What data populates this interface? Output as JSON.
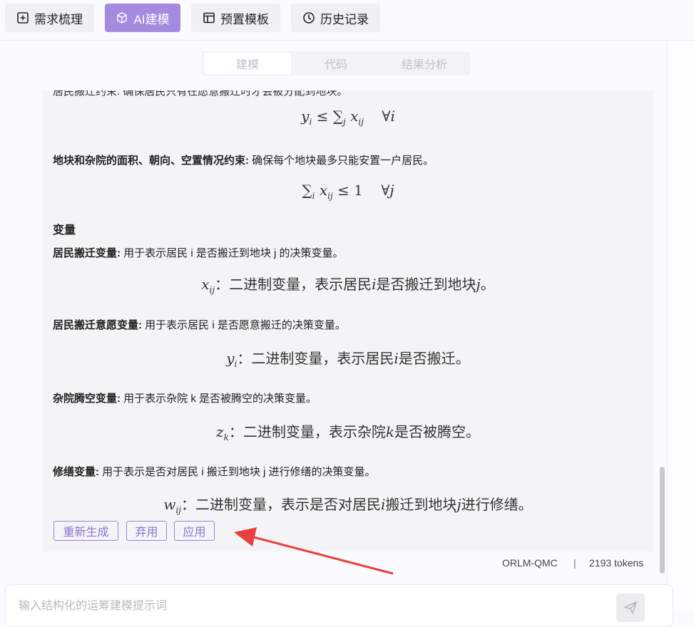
{
  "nav": {
    "items": [
      {
        "label": "需求梳理",
        "icon": "plus-square-icon"
      },
      {
        "label": "AI建模",
        "icon": "cube-icon"
      },
      {
        "label": "预置模板",
        "icon": "layout-icon"
      },
      {
        "label": "历史记录",
        "icon": "clock-icon"
      }
    ],
    "active": "AI建模",
    "accent_color": "#a58be0"
  },
  "tabs": {
    "items": [
      {
        "label": "建模"
      },
      {
        "label": "代码"
      },
      {
        "label": "结果分析"
      }
    ],
    "active": "建模"
  },
  "content": {
    "truncated_top": "居民搬迁约束: 确保居民只有在愿意搬迁时才会被分配到地块。",
    "constraint2": {
      "title": "地块和杂院的面积、朝向、空置情况约束:",
      "desc": " 确保每个地块最多只能安置一户居民。"
    },
    "variables_heading": "变量",
    "var1": {
      "title": "居民搬迁变量:",
      "desc": " 用于表示居民 i 是否搬迁到地块 j 的决策变量。",
      "formula_text": "：二进制变量，表示居民",
      "formula_mid": "是否搬迁到地块",
      "formula_end": "。"
    },
    "var2": {
      "title": "居民搬迁意愿变量:",
      "desc": " 用于表示居民 i 是否愿意搬迁的决策变量。",
      "formula_text": "：二进制变量，表示居民",
      "formula_end": "是否搬迁。"
    },
    "var3": {
      "title": "杂院腾空变量:",
      "desc": " 用于表示杂院 k 是否被腾空的决策变量。",
      "formula_text": "：二进制变量，表示杂院",
      "formula_end": "是否被腾空。"
    },
    "var4": {
      "title": "修缮变量:",
      "desc": " 用于表示是否对居民 i 搬迁到地块 j 进行修缮的决策变量。",
      "formula_text": "：二进制变量，表示是否对居民",
      "formula_mid": "搬迁到地块",
      "formula_end": "进行修缮。"
    }
  },
  "actions": {
    "regenerate": "重新生成",
    "discard": "弃用",
    "apply": "应用"
  },
  "meta": {
    "model": "ORLM-QMC",
    "separator": "|",
    "tokens": "2193 tokens"
  },
  "input": {
    "placeholder": "输入结构化的运筹建模提示词",
    "value": ""
  },
  "annotation": {
    "arrow_color": "#e8403c"
  }
}
